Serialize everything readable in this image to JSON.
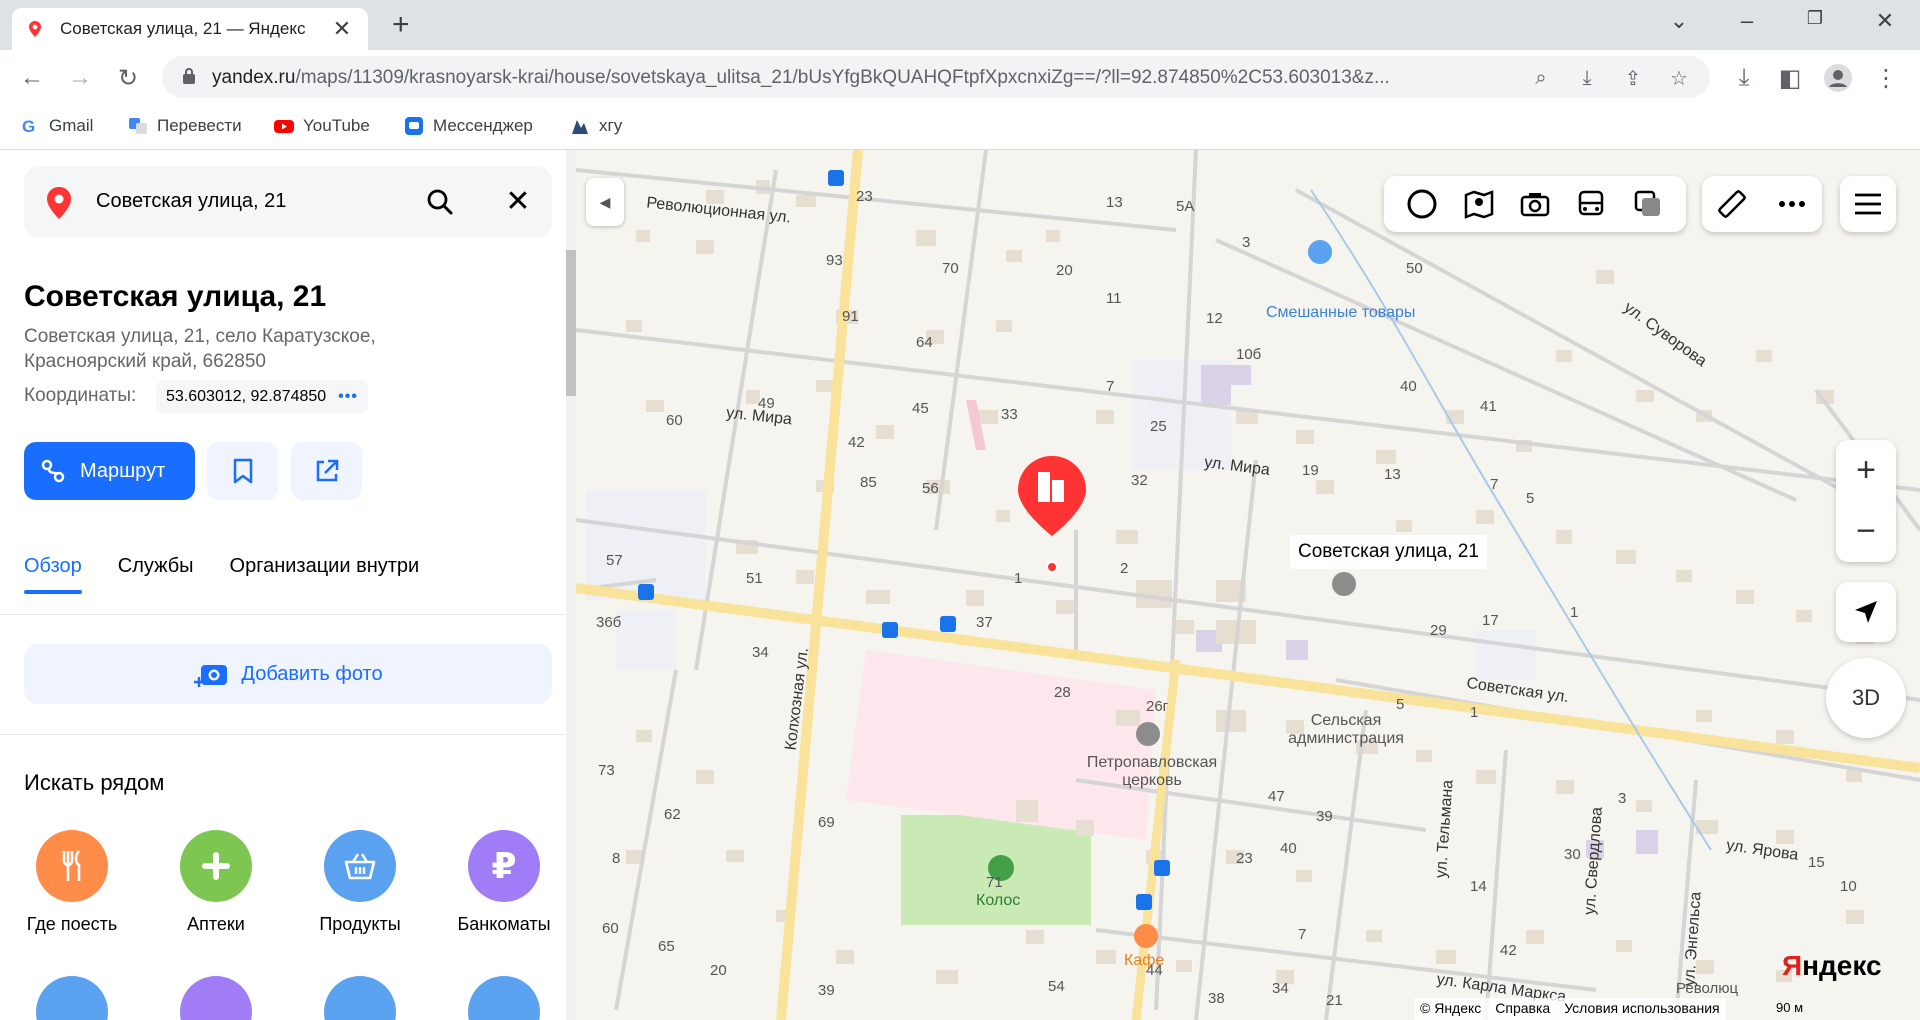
{
  "browser": {
    "tab_title": "Советская улица, 21 — Яндекс",
    "tab_close": "✕",
    "new_tab": "+",
    "url_host": "yandex.ru",
    "url_path": "/maps/11309/krasnoyarsk-krai/house/sovetskaya_ulitsa_21/bUsYfgBkQUAHQFtpfXpxcnxiZg==/?ll=92.874850%2C53.603013&z...",
    "bookmarks": [
      "Gmail",
      "Перевести",
      "YouTube",
      "Мессенджер",
      "хгу"
    ]
  },
  "panel": {
    "search_value": "Советская улица, 21",
    "title": "Советская улица, 21",
    "address_line1": "Советская улица, 21, село Каратузское,",
    "address_line2": "Красноярский край, 662850",
    "coords_label": "Координаты:",
    "coords_value": "53.603012, 92.874850",
    "coords_more": "•••",
    "route_label": "Маршрут",
    "tabs": [
      "Обзор",
      "Службы",
      "Организации внутри"
    ],
    "add_photo": "Добавить фото",
    "nearby_title": "Искать рядом",
    "categories": [
      {
        "label": "Где поесть",
        "color": "#ff8c48",
        "icon": "fork-knife-icon"
      },
      {
        "label": "Аптеки",
        "color": "#7cc651",
        "icon": "plus-icon"
      },
      {
        "label": "Продукты",
        "color": "#5aa1ef",
        "icon": "basket-icon"
      },
      {
        "label": "Банкоматы",
        "color": "#a07cf6",
        "icon": "ruble-icon"
      }
    ]
  },
  "map": {
    "pin_label": "Советская улица, 21",
    "streets": {
      "revolutsionnaya": "Революционная ул.",
      "mira_left": "ул. Мира",
      "mira_right": "ул. Мира",
      "kolkhoznaya": "Колхозная ул.",
      "sovetskaya": "Советская ул.",
      "suvorova": "ул. Суворова",
      "telmana": "ул. Тельмана",
      "sverdlova": "ул. Свердлова",
      "yarova": "ул. Ярова",
      "engelsa": "ул. Энгельса",
      "karla_marksa": "ул. Карла Маркса"
    },
    "pois": {
      "shop": "Смешанные товары",
      "admin": "Сельская администрация",
      "church": "Петропавловская церковь",
      "stadium": "Колос",
      "cafe": "Кафе"
    },
    "house_numbers": [
      "23",
      "13",
      "5А",
      "3",
      "93",
      "70",
      "20",
      "11",
      "12",
      "91",
      "64",
      "10б",
      "7",
      "50",
      "40",
      "41",
      "49",
      "45",
      "33",
      "25",
      "60",
      "42",
      "19",
      "13",
      "85",
      "56",
      "32",
      "7",
      "5",
      "57",
      "1",
      "2",
      "51",
      "37",
      "36б",
      "34",
      "29",
      "17",
      "28",
      "26г",
      "1",
      "5",
      "1",
      "73",
      "3",
      "62",
      "69",
      "47",
      "39",
      "8",
      "71",
      "23",
      "40",
      "30",
      "15",
      "14",
      "10",
      "60",
      "65",
      "20",
      "7",
      "42",
      "39",
      "54",
      "44",
      "38",
      "34",
      "21",
      "Революц"
    ],
    "controls": {
      "zoom_in": "+",
      "zoom_out": "−",
      "three_d": "3D"
    },
    "logo": "Яндекс",
    "copyright": [
      "© Яндекс",
      "Справка",
      "Условия использования"
    ],
    "scale": "90 м"
  }
}
